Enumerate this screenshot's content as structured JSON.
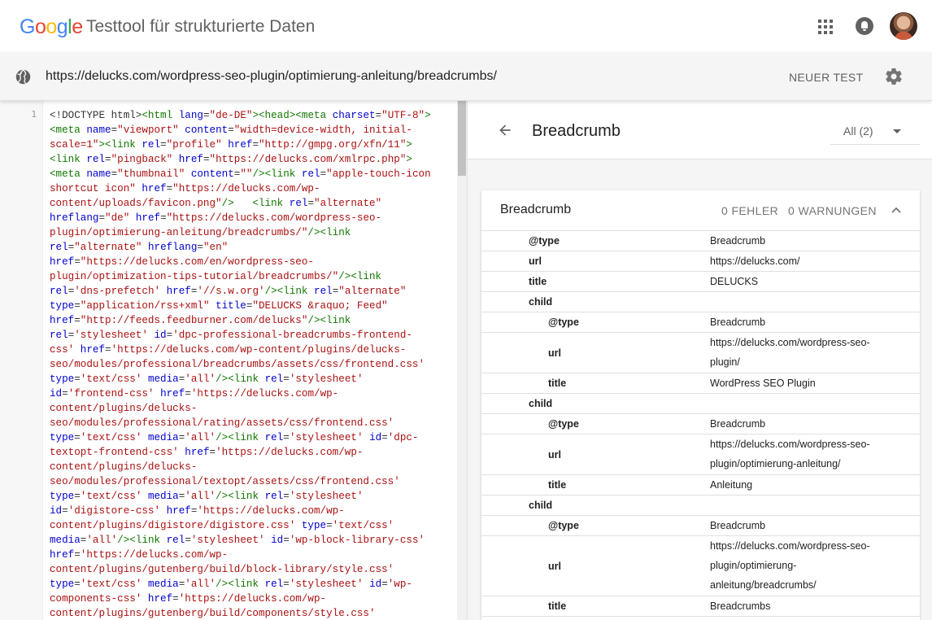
{
  "header": {
    "logo_letters": [
      {
        "ch": "G",
        "color": "#4285F4"
      },
      {
        "ch": "o",
        "color": "#EA4335"
      },
      {
        "ch": "o",
        "color": "#FBBC05"
      },
      {
        "ch": "g",
        "color": "#4285F4"
      },
      {
        "ch": "l",
        "color": "#34A853"
      },
      {
        "ch": "e",
        "color": "#EA4335"
      }
    ],
    "app_title": "Testtool für strukturierte Daten",
    "icons": [
      "apps-grid-icon",
      "notifications-icon",
      "user-avatar"
    ]
  },
  "urlbar": {
    "url": "https://delucks.com/wordpress-seo-plugin/optimierung-anleitung/breadcrumbs/",
    "new_test_label": "NEUER TEST",
    "icons": [
      "globe-icon",
      "settings-gear-icon"
    ]
  },
  "code": {
    "line_number": "1",
    "lines": [
      [
        [
          "p",
          "<!DOCTYPE html>"
        ],
        [
          "t",
          "<html "
        ],
        [
          "a",
          "lang"
        ],
        [
          "p",
          "="
        ],
        [
          "s",
          "\"de-DE\""
        ],
        [
          "t",
          "><head><meta "
        ],
        [
          "a",
          "charset"
        ],
        [
          "p",
          "="
        ],
        [
          "s",
          "\"UTF-8\""
        ],
        [
          "t",
          ">"
        ]
      ],
      [
        [
          "t",
          "<meta "
        ],
        [
          "a",
          "name"
        ],
        [
          "p",
          "="
        ],
        [
          "s",
          "\"viewport\" "
        ],
        [
          "a",
          "content"
        ],
        [
          "p",
          "="
        ],
        [
          "s",
          "\"width=device-width, initial-"
        ]
      ],
      [
        [
          "s",
          "scale=1\""
        ],
        [
          "t",
          "><link "
        ],
        [
          "a",
          "rel"
        ],
        [
          "p",
          "="
        ],
        [
          "s",
          "\"profile\" "
        ],
        [
          "a",
          "href"
        ],
        [
          "p",
          "="
        ],
        [
          "s",
          "\"http://gmpg.org/xfn/11\""
        ],
        [
          "t",
          ">"
        ]
      ],
      [
        [
          "t",
          "<link "
        ],
        [
          "a",
          "rel"
        ],
        [
          "p",
          "="
        ],
        [
          "s",
          "\"pingback\" "
        ],
        [
          "a",
          "href"
        ],
        [
          "p",
          "="
        ],
        [
          "s",
          "\"https://delucks.com/xmlrpc.php\""
        ],
        [
          "t",
          ">"
        ]
      ],
      [
        [
          "t",
          "<meta "
        ],
        [
          "a",
          "name"
        ],
        [
          "p",
          "="
        ],
        [
          "s",
          "\"thumbnail\" "
        ],
        [
          "a",
          "content"
        ],
        [
          "p",
          "="
        ],
        [
          "s",
          "\"\""
        ],
        [
          "t",
          "/><link "
        ],
        [
          "a",
          "rel"
        ],
        [
          "p",
          "="
        ],
        [
          "s",
          "\"apple-touch-icon"
        ]
      ],
      [
        [
          "s",
          "shortcut icon\" "
        ],
        [
          "a",
          "href"
        ],
        [
          "p",
          "="
        ],
        [
          "s",
          "\"https://delucks.com/wp-"
        ]
      ],
      [
        [
          "s",
          "content/uploads/favicon.png\""
        ],
        [
          "t",
          "/>   <link "
        ],
        [
          "a",
          "rel"
        ],
        [
          "p",
          "="
        ],
        [
          "s",
          "\"alternate\""
        ]
      ],
      [
        [
          "a",
          "hreflang"
        ],
        [
          "p",
          "="
        ],
        [
          "s",
          "\"de\" "
        ],
        [
          "a",
          "href"
        ],
        [
          "p",
          "="
        ],
        [
          "s",
          "\"https://delucks.com/wordpress-seo-"
        ]
      ],
      [
        [
          "s",
          "plugin/optimierung-anleitung/breadcrumbs/\""
        ],
        [
          "t",
          "/><link"
        ]
      ],
      [
        [
          "a",
          "rel"
        ],
        [
          "p",
          "="
        ],
        [
          "s",
          "\"alternate\" "
        ],
        [
          "a",
          "hreflang"
        ],
        [
          "p",
          "="
        ],
        [
          "s",
          "\"en\""
        ]
      ],
      [
        [
          "a",
          "href"
        ],
        [
          "p",
          "="
        ],
        [
          "s",
          "\"https://delucks.com/en/wordpress-seo-"
        ]
      ],
      [
        [
          "s",
          "plugin/optimization-tips-tutorial/breadcrumbs/\""
        ],
        [
          "t",
          "/><link"
        ]
      ],
      [
        [
          "a",
          "rel"
        ],
        [
          "p",
          "="
        ],
        [
          "s",
          "'dns-prefetch' "
        ],
        [
          "a",
          "href"
        ],
        [
          "p",
          "="
        ],
        [
          "s",
          "'//s.w.org'"
        ],
        [
          "t",
          "/><link "
        ],
        [
          "a",
          "rel"
        ],
        [
          "p",
          "="
        ],
        [
          "s",
          "\"alternate\""
        ]
      ],
      [
        [
          "a",
          "type"
        ],
        [
          "p",
          "="
        ],
        [
          "s",
          "\"application/rss+xml\" "
        ],
        [
          "a",
          "title"
        ],
        [
          "p",
          "="
        ],
        [
          "s",
          "\"DELUCKS &raquo; Feed\""
        ]
      ],
      [
        [
          "a",
          "href"
        ],
        [
          "p",
          "="
        ],
        [
          "s",
          "\"http://feeds.feedburner.com/delucks\""
        ],
        [
          "t",
          "/><link"
        ]
      ],
      [
        [
          "a",
          "rel"
        ],
        [
          "p",
          "="
        ],
        [
          "s",
          "'stylesheet' "
        ],
        [
          "a",
          "id"
        ],
        [
          "p",
          "="
        ],
        [
          "s",
          "'dpc-professional-breadcrumbs-frontend-"
        ]
      ],
      [
        [
          "s",
          "css' "
        ],
        [
          "a",
          "href"
        ],
        [
          "p",
          "="
        ],
        [
          "s",
          "'https://delucks.com/wp-content/plugins/delucks-"
        ]
      ],
      [
        [
          "s",
          "seo/modules/professional/breadcrumbs/assets/css/frontend.css'"
        ]
      ],
      [
        [
          "a",
          "type"
        ],
        [
          "p",
          "="
        ],
        [
          "s",
          "'text/css' "
        ],
        [
          "a",
          "media"
        ],
        [
          "p",
          "="
        ],
        [
          "s",
          "'all'"
        ],
        [
          "t",
          "/><link "
        ],
        [
          "a",
          "rel"
        ],
        [
          "p",
          "="
        ],
        [
          "s",
          "'stylesheet'"
        ]
      ],
      [
        [
          "a",
          "id"
        ],
        [
          "p",
          "="
        ],
        [
          "s",
          "'frontend-css' "
        ],
        [
          "a",
          "href"
        ],
        [
          "p",
          "="
        ],
        [
          "s",
          "'https://delucks.com/wp-"
        ]
      ],
      [
        [
          "s",
          "content/plugins/delucks-"
        ]
      ],
      [
        [
          "s",
          "seo/modules/professional/rating/assets/css/frontend.css'"
        ]
      ],
      [
        [
          "a",
          "type"
        ],
        [
          "p",
          "="
        ],
        [
          "s",
          "'text/css' "
        ],
        [
          "a",
          "media"
        ],
        [
          "p",
          "="
        ],
        [
          "s",
          "'all'"
        ],
        [
          "t",
          "/><link "
        ],
        [
          "a",
          "rel"
        ],
        [
          "p",
          "="
        ],
        [
          "s",
          "'stylesheet' "
        ],
        [
          "a",
          "id"
        ],
        [
          "p",
          "="
        ],
        [
          "s",
          "'dpc-"
        ]
      ],
      [
        [
          "s",
          "textopt-frontend-css' "
        ],
        [
          "a",
          "href"
        ],
        [
          "p",
          "="
        ],
        [
          "s",
          "'https://delucks.com/wp-"
        ]
      ],
      [
        [
          "s",
          "content/plugins/delucks-"
        ]
      ],
      [
        [
          "s",
          "seo/modules/professional/textopt/assets/css/frontend.css'"
        ]
      ],
      [
        [
          "a",
          "type"
        ],
        [
          "p",
          "="
        ],
        [
          "s",
          "'text/css' "
        ],
        [
          "a",
          "media"
        ],
        [
          "p",
          "="
        ],
        [
          "s",
          "'all'"
        ],
        [
          "t",
          "/><link "
        ],
        [
          "a",
          "rel"
        ],
        [
          "p",
          "="
        ],
        [
          "s",
          "'stylesheet'"
        ]
      ],
      [
        [
          "a",
          "id"
        ],
        [
          "p",
          "="
        ],
        [
          "s",
          "'digistore-css' "
        ],
        [
          "a",
          "href"
        ],
        [
          "p",
          "="
        ],
        [
          "s",
          "'https://delucks.com/wp-"
        ]
      ],
      [
        [
          "s",
          "content/plugins/digistore/digistore.css' "
        ],
        [
          "a",
          "type"
        ],
        [
          "p",
          "="
        ],
        [
          "s",
          "'text/css'"
        ]
      ],
      [
        [
          "a",
          "media"
        ],
        [
          "p",
          "="
        ],
        [
          "s",
          "'all'"
        ],
        [
          "t",
          "/><link "
        ],
        [
          "a",
          "rel"
        ],
        [
          "p",
          "="
        ],
        [
          "s",
          "'stylesheet' "
        ],
        [
          "a",
          "id"
        ],
        [
          "p",
          "="
        ],
        [
          "s",
          "'wp-block-library-css'"
        ]
      ],
      [
        [
          "a",
          "href"
        ],
        [
          "p",
          "="
        ],
        [
          "s",
          "'https://delucks.com/wp-"
        ]
      ],
      [
        [
          "s",
          "content/plugins/gutenberg/build/block-library/style.css'"
        ]
      ],
      [
        [
          "a",
          "type"
        ],
        [
          "p",
          "="
        ],
        [
          "s",
          "'text/css' "
        ],
        [
          "a",
          "media"
        ],
        [
          "p",
          "="
        ],
        [
          "s",
          "'all'"
        ],
        [
          "t",
          "/><link "
        ],
        [
          "a",
          "rel"
        ],
        [
          "p",
          "="
        ],
        [
          "s",
          "'stylesheet' "
        ],
        [
          "a",
          "id"
        ],
        [
          "p",
          "="
        ],
        [
          "s",
          "'wp-"
        ]
      ],
      [
        [
          "s",
          "components-css' "
        ],
        [
          "a",
          "href"
        ],
        [
          "p",
          "="
        ],
        [
          "s",
          "'https://delucks.com/wp-"
        ]
      ],
      [
        [
          "s",
          "content/plugins/gutenberg/build/components/style.css'"
        ]
      ]
    ]
  },
  "result": {
    "title": "Breadcrumb",
    "filter_label": "All (2)",
    "card": {
      "title": "Breadcrumb",
      "errors": "0 FEHLER",
      "warnings": "0 WARNUNGEN",
      "rows": [
        {
          "key": "@type",
          "value": "Breadcrumb",
          "indent": 1
        },
        {
          "key": "url",
          "value": "https://delucks.com/",
          "indent": 1
        },
        {
          "key": "title",
          "value": "DELUCKS",
          "indent": 1
        },
        {
          "key": "child",
          "value": "",
          "indent": 1
        },
        {
          "key": "@type",
          "value": "Breadcrumb",
          "indent": 2
        },
        {
          "key": "url",
          "value": "https://delucks.com/wordpress-seo-\nplugin/",
          "indent": 2
        },
        {
          "key": "title",
          "value": "WordPress SEO Plugin",
          "indent": 2
        },
        {
          "key": "child",
          "value": "",
          "indent": 1
        },
        {
          "key": "@type",
          "value": "Breadcrumb",
          "indent": 2
        },
        {
          "key": "url",
          "value": "https://delucks.com/wordpress-seo-\nplugin/optimierung-anleitung/",
          "indent": 2
        },
        {
          "key": "title",
          "value": "Anleitung",
          "indent": 2
        },
        {
          "key": "child",
          "value": "",
          "indent": 1
        },
        {
          "key": "@type",
          "value": "Breadcrumb",
          "indent": 2
        },
        {
          "key": "url",
          "value": "https://delucks.com/wordpress-seo-\nplugin/optimierung-\nanleitung/breadcrumbs/",
          "indent": 2
        },
        {
          "key": "title",
          "value": "Breadcrumbs",
          "indent": 2
        }
      ]
    }
  }
}
